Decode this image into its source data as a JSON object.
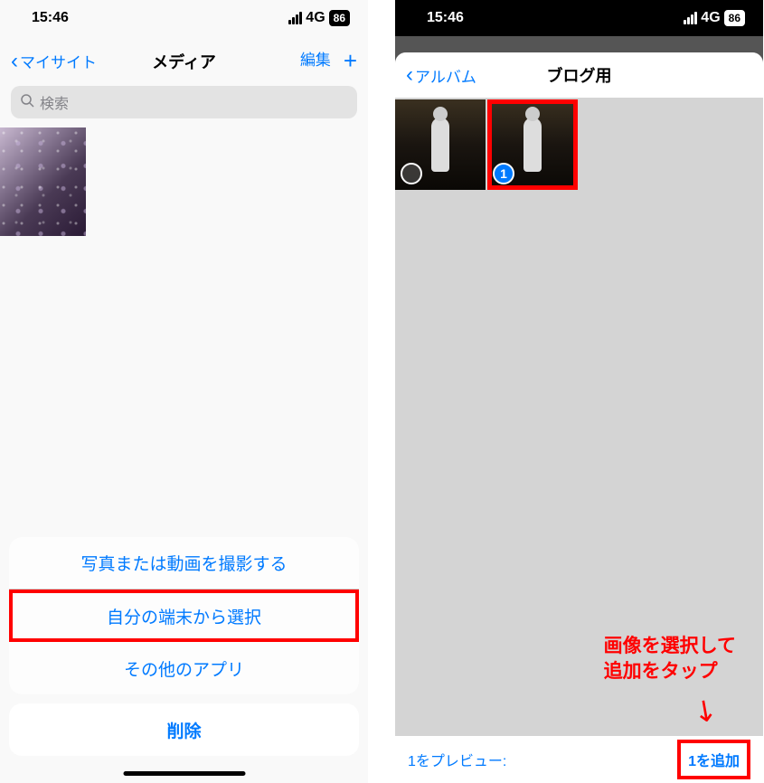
{
  "status": {
    "time": "15:46",
    "network": "4G",
    "battery": "86"
  },
  "left": {
    "nav_back": "マイサイト",
    "nav_title": "メディア",
    "nav_edit": "編集",
    "search_placeholder": "検索",
    "action_sheet": {
      "item1": "写真または動画を撮影する",
      "item2": "自分の端末から選択",
      "item3": "その他のアプリ",
      "cancel": "削除"
    }
  },
  "right": {
    "nav_back": "アルバム",
    "nav_title": "ブログ用",
    "selected_num": "1",
    "preview_label": "1をプレビュー:",
    "add_label": "1を追加",
    "annotation_line1": "画像を選択して",
    "annotation_line2": "追加をタップ"
  }
}
